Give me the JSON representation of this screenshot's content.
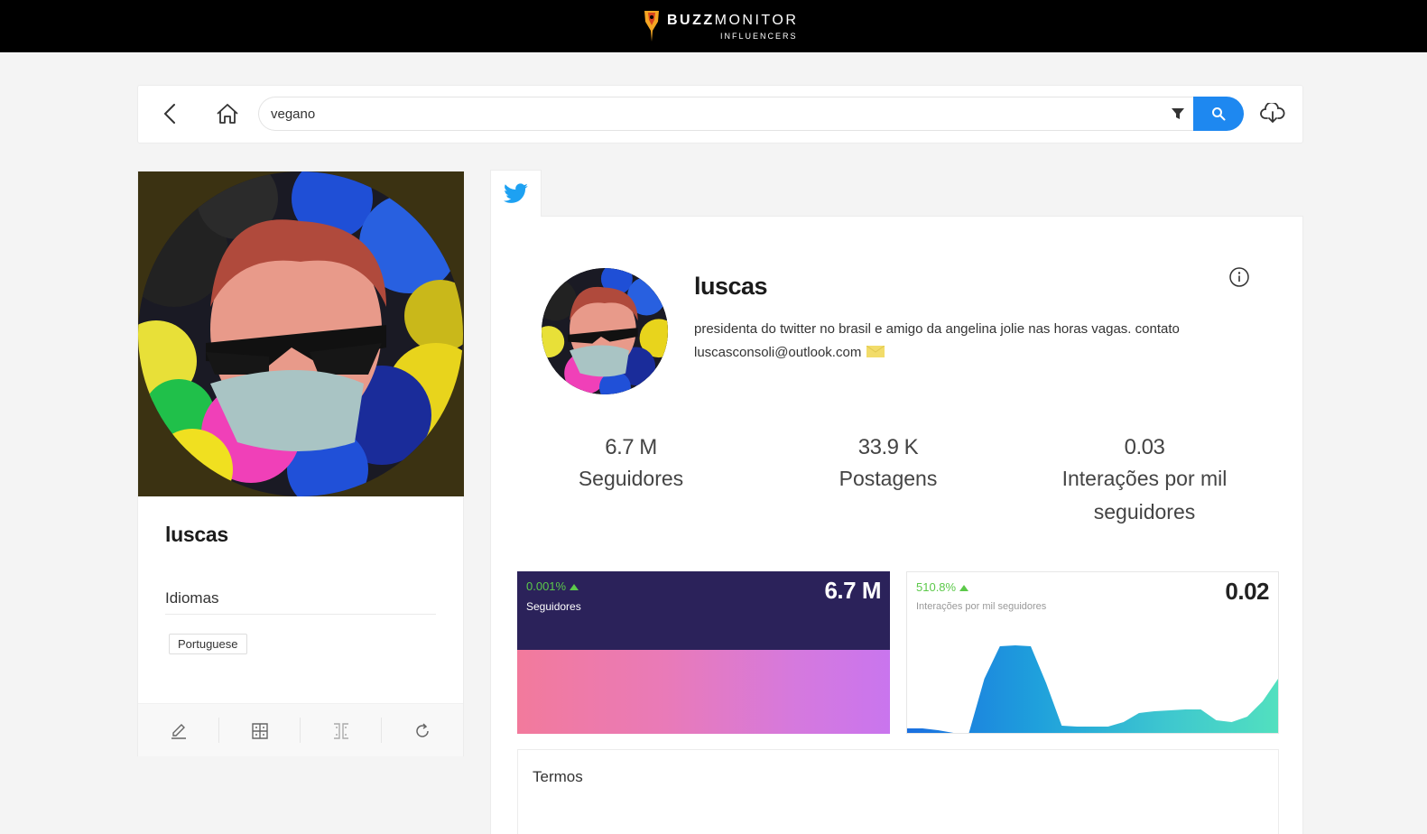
{
  "brand": {
    "name_bold": "BUZZ",
    "name_rest": "MONITOR",
    "subtitle": "INFLUENCERS",
    "accent": "#f5a623"
  },
  "search": {
    "query": "vegano",
    "icons": {
      "back": "chevron-left-icon",
      "home": "home-icon",
      "filter": "funnel-icon",
      "search": "search-icon",
      "download": "cloud-download-icon"
    },
    "button_color": "#1e88f0"
  },
  "left_card": {
    "name": "luscas",
    "languages_title": "Idiomas",
    "languages": [
      "Portuguese"
    ],
    "actions": [
      "pencil-icon",
      "expand-icon",
      "collapse-icon",
      "refresh-icon"
    ]
  },
  "network_tab": {
    "icon": "twitter-icon",
    "color": "#1da1f2"
  },
  "profile": {
    "name": "luscas",
    "bio_line1": "presidenta do twitter no brasil e amigo da angelina jolie nas horas vagas. contato",
    "bio_line2": "luscasconsoli@outlook.com",
    "stats": [
      {
        "value": "6.7 M",
        "label_line1": "Seguidores",
        "label_line2": ""
      },
      {
        "value": "33.9 K",
        "label_line1": "Postagens",
        "label_line2": ""
      },
      {
        "value": "0.03",
        "label_line1": "Interações por mil",
        "label_line2": "seguidores"
      }
    ]
  },
  "sparklines": {
    "followers": {
      "change": "0.001%",
      "label": "Seguidores",
      "value": "6.7 M",
      "trend": "up"
    },
    "interactions": {
      "change": "510.8%",
      "label": "Interações por mil seguidores",
      "value": "0.02",
      "trend": "up"
    }
  },
  "chart_data": {
    "type": "area",
    "x": [
      0,
      1,
      2,
      3,
      4,
      5,
      6,
      7,
      8,
      9,
      10,
      11,
      12,
      13,
      14,
      15,
      16,
      17,
      18,
      19,
      20,
      21,
      22,
      23,
      24
    ],
    "series": [
      {
        "values": [
          5,
          5,
          3,
          0,
          0,
          60,
          96,
          97,
          96,
          55,
          8,
          7,
          7,
          7,
          12,
          22,
          24,
          25,
          26,
          26,
          14,
          12,
          18,
          35,
          60
        ]
      }
    ],
    "ylim": [
      0,
      100
    ],
    "colors": [
      "#1a6fe0",
      "#1fa0dc",
      "#3ec7cf",
      "#52e0bf"
    ]
  },
  "termos": {
    "title": "Termos"
  }
}
